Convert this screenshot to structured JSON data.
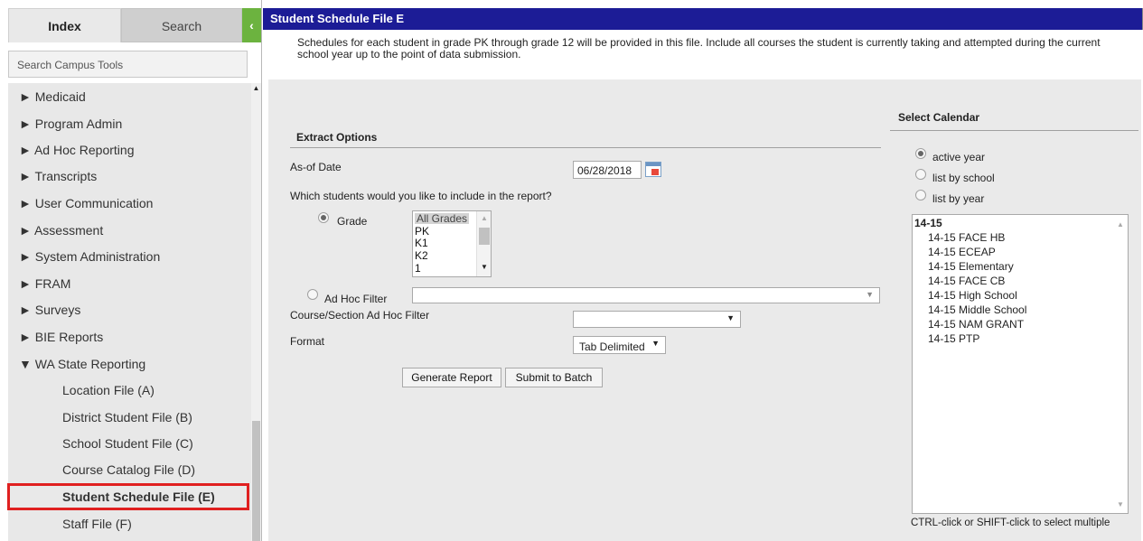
{
  "sidebar": {
    "tabs": {
      "index": "Index",
      "search": "Search",
      "collapse": "‹"
    },
    "search_tools": "Search Campus Tools",
    "scroll_up": "▲",
    "items": [
      {
        "label": "► Medicaid"
      },
      {
        "label": "► Program Admin"
      },
      {
        "label": "► Ad Hoc Reporting"
      },
      {
        "label": "► Transcripts"
      },
      {
        "label": "► User Communication"
      },
      {
        "label": "► Assessment"
      },
      {
        "label": "► System Administration"
      },
      {
        "label": "► FRAM"
      },
      {
        "label": "► Surveys"
      },
      {
        "label": "► BIE Reports"
      },
      {
        "label": "▼ WA State Reporting"
      },
      {
        "label": "Location File (A)"
      },
      {
        "label": "District Student File (B)"
      },
      {
        "label": "School Student File (C)"
      },
      {
        "label": "Course Catalog File (D)"
      },
      {
        "label": "Student Schedule File (E)"
      },
      {
        "label": "Staff File (F)"
      }
    ]
  },
  "main": {
    "title": "Student Schedule File E",
    "description": "Schedules for each student in grade PK through grade 12 will be provided in this file. Include all courses the student is currently taking and attempted during the current school year up to the point of data submission.",
    "extract_options": {
      "heading": "Extract Options",
      "asof_label": "As-of Date",
      "asof_value": "06/28/2018",
      "students_question": "Which students would you like to include in the report?",
      "grade_label": "Grade",
      "grade_options": [
        "All Grades",
        "PK",
        "K1",
        "K2",
        "1"
      ],
      "adhoc_label": "Ad Hoc Filter",
      "adhoc_value": "",
      "course_filter_label": "Course/Section Ad Hoc Filter",
      "course_filter_value": "",
      "format_label": "Format",
      "format_value": "Tab Delimited",
      "generate_button": "Generate Report",
      "batch_button": "Submit to Batch",
      "dropdown_arrow": "▼"
    },
    "calendar": {
      "heading": "Select Calendar",
      "radio_active_year": "active year",
      "radio_by_school": "list by school",
      "radio_by_year": "list by year",
      "year": "14-15",
      "options": [
        "14-15 FACE HB",
        "14-15 ECEAP",
        "14-15 Elementary",
        "14-15 FACE CB",
        "14-15 High School",
        "14-15 Middle School",
        "14-15 NAM GRANT",
        "14-15 PTP"
      ],
      "hint": "CTRL-click or SHIFT-click to select multiple"
    }
  }
}
